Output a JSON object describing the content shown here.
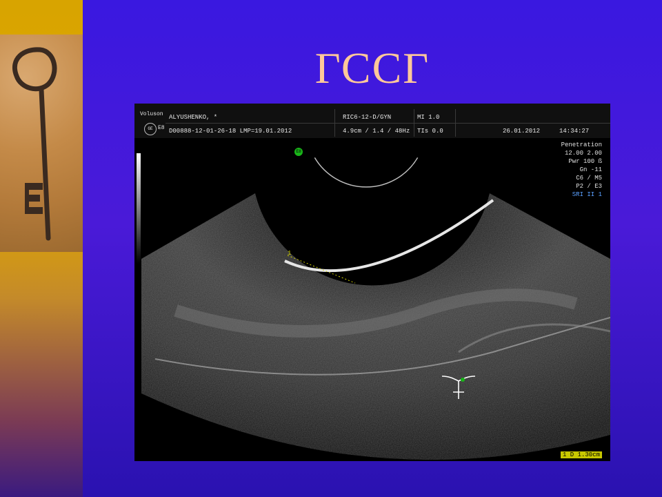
{
  "slide": {
    "title": "ГССГ"
  },
  "ultrasound": {
    "header": {
      "device_top": "Voluson",
      "device_bottom": "E8",
      "patient": "ALYUSHENKO, *",
      "probe": "RIC6-12-D/GYN",
      "mi": "MI  1.0",
      "patient_id": "D00888-12-01-26-18  LMP=19.01.2012",
      "depth": "4.9cm / 1.4 / 48Hz",
      "tis": "TIs  0.0",
      "date": "26.01.2012",
      "time": "14:34:27"
    },
    "params": [
      "Penetration",
      "12.00    2.00",
      "Pwr 100 ß",
      "Gn -11",
      "C6 / M5",
      "P2 / E3"
    ],
    "params_blue": "SRI II 1",
    "marker": "E8",
    "measurement": "1  D 1.30cm",
    "caliper_label": "1"
  }
}
